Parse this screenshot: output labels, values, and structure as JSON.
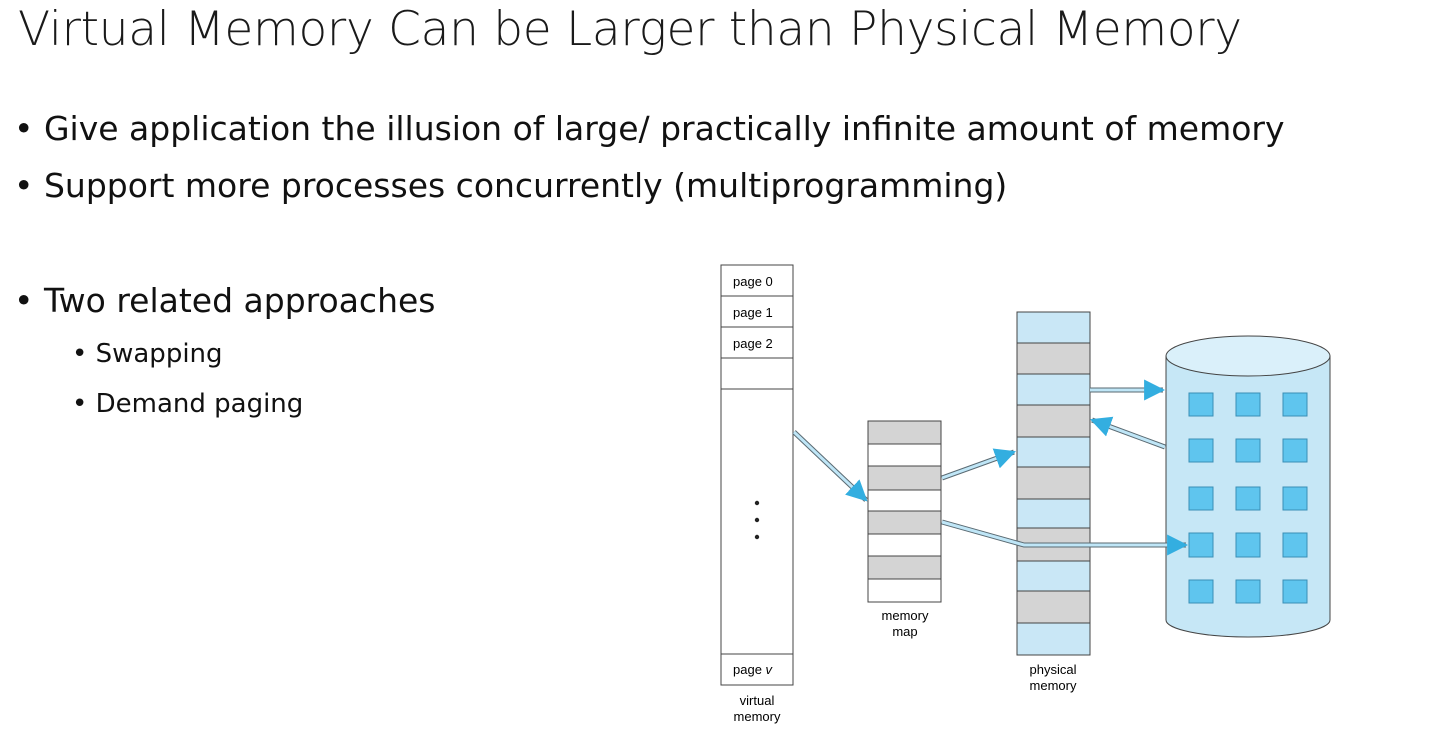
{
  "slide": {
    "title": "Virtual Memory Can be Larger than Physical Memory",
    "bullets": [
      "Give application the illusion of large/ practically infinite amount of memory",
      "Support more processes concurrently (multiprogramming)",
      "Two related approaches"
    ],
    "sub_bullets": [
      "Swapping",
      "Demand paging"
    ],
    "bullet_glyph": "•"
  },
  "diagram": {
    "virtual_memory": {
      "pages": [
        "page 0",
        "page 1",
        "page 2"
      ],
      "last_page_prefix": "page ",
      "last_page_var": "v",
      "caption_line1": "virtual",
      "caption_line2": "memory"
    },
    "memory_map": {
      "caption_line1": "memory",
      "caption_line2": "map"
    },
    "physical_memory": {
      "caption_line1": "physical",
      "caption_line2": "memory"
    },
    "colors": {
      "light_blue": "#c9e7f6",
      "gray_block": "#d4d4d4",
      "disk_fill": "#c6e7f6",
      "disk_square": "#5fc5ee",
      "arrow": "#33aee0",
      "outline": "#444444"
    }
  }
}
